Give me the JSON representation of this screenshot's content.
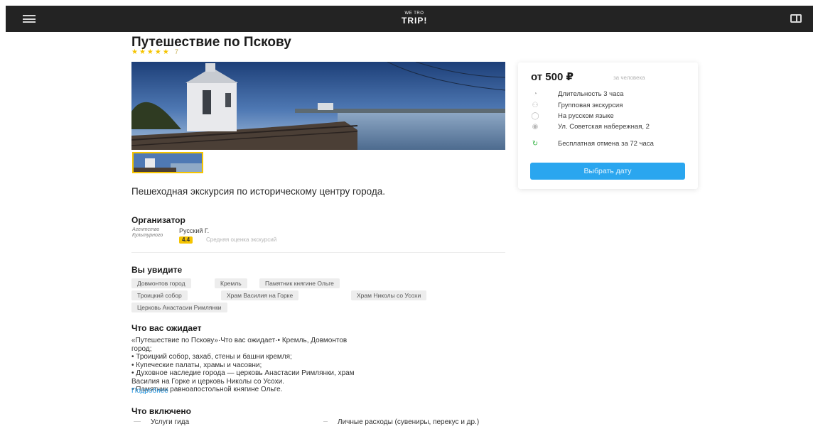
{
  "header": {
    "logo_small": "WE TRO",
    "logo_big": "TRIP!"
  },
  "tour": {
    "title": "Путешествие по Пскову",
    "stars": "★★★★★",
    "review_count": "7",
    "subtitle": "Пешеходная экскурсия по историческому центру города."
  },
  "organizer": {
    "heading": "Организатор",
    "logo_text": "Агентство Культурного",
    "name": "Русский Г.",
    "rating": "4.4",
    "rating_note": "Средняя оценка экскурсий"
  },
  "sights": {
    "heading": "Вы увидите",
    "tags": [
      "Довмонтов город",
      "Кремль",
      "Памятник княгине Ольге",
      "Троицкий собор",
      "Храм Василия на Горке",
      "Храм Николы со Усохи",
      "Церковь Анастасии Римлянки"
    ]
  },
  "expect": {
    "heading": "Что вас ожидает",
    "lines": [
      "«Путешествие по Пскову»·Что вас ожидает·• Кремль, Довмонтов",
      "город;",
      "• Троицкий собор, захаб, стены и башни кремля;",
      "• Купеческие палаты, храмы и часовни;",
      "• Духовное наследие города — церковь Анастасии Римлянки, храм",
      "Василия на Горке и церковь Николы со Усохи.",
      "• Памятник равноапостольной княгине Ольге."
    ],
    "more_link": "Подробнее"
  },
  "included": {
    "heading": "Что включено",
    "included_item": "Услуги гида",
    "excluded_item": "Личные расходы (сувениры, перекус и др.)"
  },
  "booking": {
    "price": "от 500 ₽",
    "price_note": "за человека",
    "features": [
      {
        "icon": "clock-icon",
        "glyph": "◔",
        "text": "Длительность 3 часа"
      },
      {
        "icon": "group-icon",
        "glyph": "⚇",
        "text": "Групповая экскурсия"
      },
      {
        "icon": "language-icon",
        "glyph": "◯",
        "text": "На русском языке"
      },
      {
        "icon": "location-pin-icon",
        "glyph": "◉",
        "text": "Ул. Советская набережная, 2"
      },
      {
        "icon": "refresh-icon",
        "glyph": "↻",
        "text": "Бесплатная отмена за 72 часа"
      }
    ],
    "button_label": "Выбрать дату"
  },
  "colors": {
    "accent_blue": "#2aa6ef",
    "star_yellow": "#f5c400",
    "header_bg": "#232323",
    "cancel_green": "#3bb54a"
  }
}
